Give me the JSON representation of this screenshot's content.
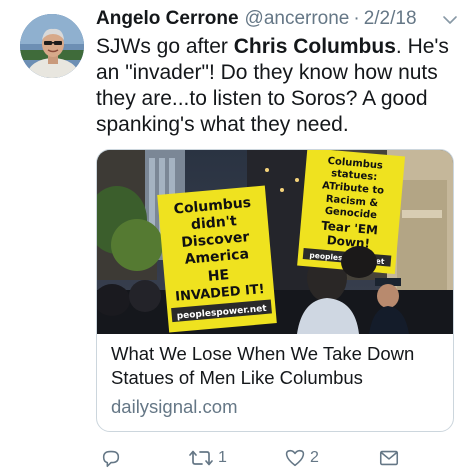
{
  "author": {
    "name": "Angelo Cerrone",
    "handle": "@ancerrone",
    "separator": "·",
    "date": "2/2/18"
  },
  "tweet": {
    "text_1": "SJWs go after ",
    "text_bold": "Chris Columbus",
    "text_2": ". He's an \"invader\"! Do they know how nuts they are...to listen to Soros? A good spanking's what they need."
  },
  "card": {
    "left_sign": {
      "line1": "Columbus",
      "line2": "didn't",
      "line3": "Discover",
      "line4": "America",
      "line5": "HE",
      "line6": "INVADED IT!",
      "url": "peoplespower.net"
    },
    "right_sign": {
      "line1": "Columbus",
      "line2": "statues:",
      "line3": "ATribute to",
      "line4": "Racism &",
      "line5": "Genocide",
      "line6": "Tear 'EM",
      "line7": "Down!",
      "url": "peoplespower.net"
    },
    "title": "What We Lose When We Take Down Statues of Men Like Columbus",
    "domain": "dailysignal.com"
  },
  "actions": {
    "reply_icon": "reply-icon",
    "retweet_icon": "retweet-icon",
    "retweet_count": "1",
    "like_icon": "heart-icon",
    "like_count": "2",
    "dm_icon": "envelope-icon"
  },
  "colors": {
    "text": "#14171a",
    "secondary": "#657786",
    "border": "#ccd6dd",
    "sign_yellow": "#f2e31c"
  }
}
